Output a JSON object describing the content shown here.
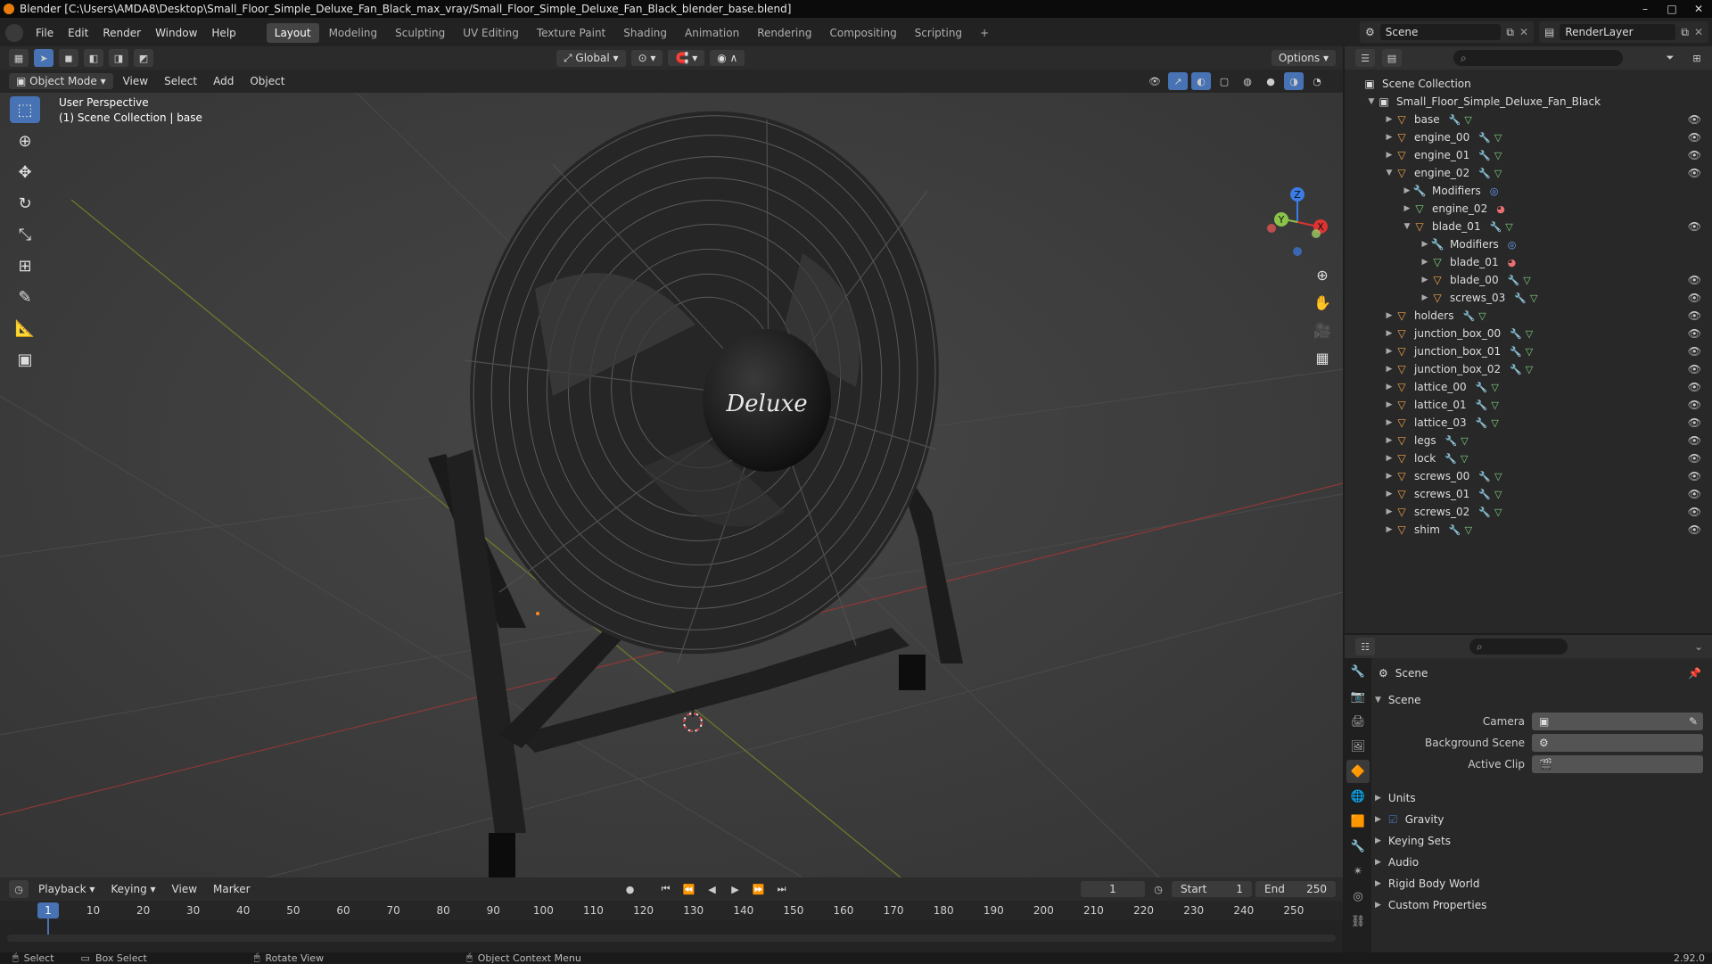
{
  "window": {
    "title": "Blender [C:\\Users\\AMDA8\\Desktop\\Small_Floor_Simple_Deluxe_Fan_Black_max_vray/Small_Floor_Simple_Deluxe_Fan_Black_blender_base.blend]"
  },
  "menu": [
    "File",
    "Edit",
    "Render",
    "Window",
    "Help"
  ],
  "workspaces": [
    {
      "label": "Layout",
      "active": true
    },
    {
      "label": "Modeling"
    },
    {
      "label": "Sculpting"
    },
    {
      "label": "UV Editing"
    },
    {
      "label": "Texture Paint"
    },
    {
      "label": "Shading"
    },
    {
      "label": "Animation"
    },
    {
      "label": "Rendering"
    },
    {
      "label": "Compositing"
    },
    {
      "label": "Scripting"
    }
  ],
  "add_workspace": "+",
  "scene": {
    "label": "Scene"
  },
  "render_layer": {
    "label": "RenderLayer"
  },
  "viewport_header": {
    "transform_orientation": "Global",
    "options": "Options",
    "mode": "Object Mode",
    "menus": [
      "View",
      "Select",
      "Add",
      "Object"
    ]
  },
  "viewport": {
    "view_name": "User Perspective",
    "collection_info": "(1) Scene Collection | base",
    "logo_text": "Deluxe",
    "axis_labels": {
      "x": "X",
      "y": "Y",
      "z": "Z"
    }
  },
  "outliner": {
    "root": "Scene Collection",
    "items": [
      {
        "label": "Small_Floor_Simple_Deluxe_Fan_Black",
        "depth": 1,
        "kind": "collection",
        "expanded": true
      },
      {
        "label": "base",
        "depth": 2,
        "kind": "object",
        "expanded": false,
        "eye": true
      },
      {
        "label": "engine_00",
        "depth": 2,
        "kind": "object",
        "expanded": false,
        "eye": true
      },
      {
        "label": "engine_01",
        "depth": 2,
        "kind": "object",
        "expanded": false,
        "eye": true
      },
      {
        "label": "engine_02",
        "depth": 2,
        "kind": "object",
        "expanded": true,
        "eye": true
      },
      {
        "label": "Modifiers",
        "depth": 3,
        "kind": "modifiers",
        "expanded": false
      },
      {
        "label": "engine_02",
        "depth": 3,
        "kind": "mesh",
        "expanded": false
      },
      {
        "label": "blade_01",
        "depth": 3,
        "kind": "object",
        "expanded": true,
        "eye": true
      },
      {
        "label": "Modifiers",
        "depth": 4,
        "kind": "modifiers",
        "expanded": false
      },
      {
        "label": "blade_01",
        "depth": 4,
        "kind": "mesh",
        "expanded": false
      },
      {
        "label": "blade_00",
        "depth": 4,
        "kind": "object",
        "expanded": false,
        "eye": true
      },
      {
        "label": "screws_03",
        "depth": 4,
        "kind": "object",
        "expanded": false,
        "eye": true
      },
      {
        "label": "holders",
        "depth": 2,
        "kind": "object",
        "expanded": false,
        "eye": true
      },
      {
        "label": "junction_box_00",
        "depth": 2,
        "kind": "object",
        "expanded": false,
        "eye": true
      },
      {
        "label": "junction_box_01",
        "depth": 2,
        "kind": "object",
        "expanded": false,
        "eye": true
      },
      {
        "label": "junction_box_02",
        "depth": 2,
        "kind": "object",
        "expanded": false,
        "eye": true
      },
      {
        "label": "lattice_00",
        "depth": 2,
        "kind": "object",
        "expanded": false,
        "eye": true
      },
      {
        "label": "lattice_01",
        "depth": 2,
        "kind": "object",
        "expanded": false,
        "eye": true
      },
      {
        "label": "lattice_03",
        "depth": 2,
        "kind": "object",
        "expanded": false,
        "eye": true
      },
      {
        "label": "legs",
        "depth": 2,
        "kind": "object",
        "expanded": false,
        "eye": true
      },
      {
        "label": "lock",
        "depth": 2,
        "kind": "object",
        "expanded": false,
        "eye": true
      },
      {
        "label": "screws_00",
        "depth": 2,
        "kind": "object",
        "expanded": false,
        "eye": true
      },
      {
        "label": "screws_01",
        "depth": 2,
        "kind": "object",
        "expanded": false,
        "eye": true
      },
      {
        "label": "screws_02",
        "depth": 2,
        "kind": "object",
        "expanded": false,
        "eye": true
      },
      {
        "label": "shim",
        "depth": 2,
        "kind": "object",
        "expanded": false,
        "eye": true
      }
    ]
  },
  "properties": {
    "context": "Scene",
    "panel": "Scene",
    "fields": [
      {
        "label": "Camera",
        "value": ""
      },
      {
        "label": "Background Scene",
        "value": ""
      },
      {
        "label": "Active Clip",
        "value": ""
      }
    ],
    "sections": [
      {
        "label": "Units"
      },
      {
        "label": "Gravity",
        "checkbox": true
      },
      {
        "label": "Keying Sets"
      },
      {
        "label": "Audio"
      },
      {
        "label": "Rigid Body World"
      },
      {
        "label": "Custom Properties"
      }
    ]
  },
  "timeline": {
    "menus": [
      "Playback",
      "Keying",
      "View",
      "Marker"
    ],
    "current_frame": "1",
    "start_label": "Start",
    "start": "1",
    "end_label": "End",
    "end": "250",
    "ticks": [
      "10",
      "20",
      "30",
      "40",
      "50",
      "60",
      "70",
      "80",
      "90",
      "100",
      "110",
      "120",
      "130",
      "140",
      "150",
      "160",
      "170",
      "180",
      "190",
      "200",
      "210",
      "220",
      "230",
      "240",
      "250"
    ],
    "playhead_value": "1"
  },
  "statusbar": {
    "select": "Select",
    "box_select": "Box Select",
    "rotate_view": "Rotate View",
    "context_menu": "Object Context Menu",
    "version": "2.92.0"
  },
  "colors": {
    "accent": "#4772b3",
    "object": "#f0a44a",
    "mesh": "#7fd27f",
    "modifier": "#7ea9ff"
  }
}
